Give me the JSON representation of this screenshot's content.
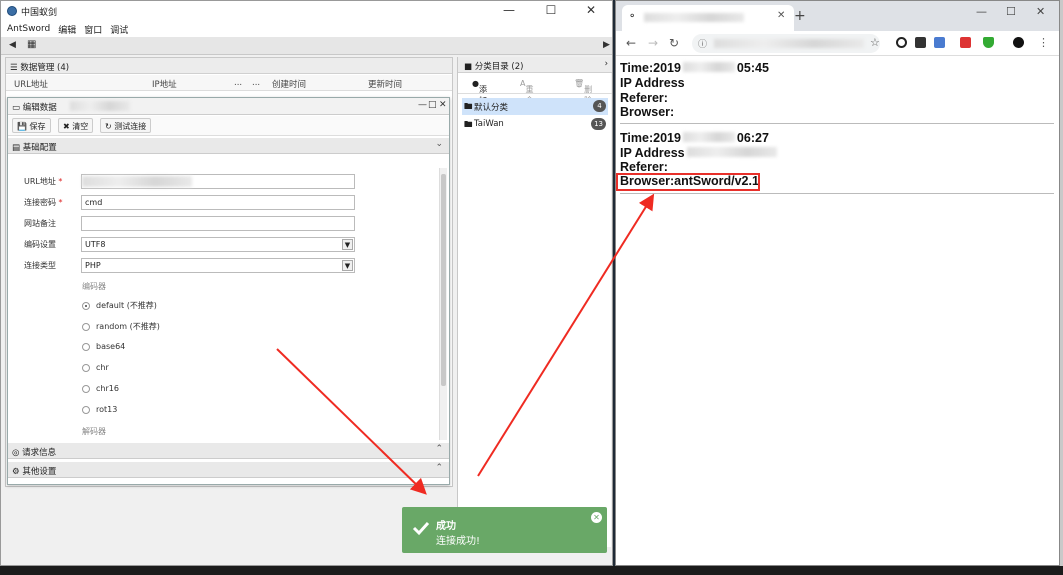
{
  "antsword": {
    "title": "中国蚁剑",
    "menu": [
      "AntSword",
      "编辑",
      "窗口",
      "调试"
    ],
    "data_panel": {
      "header": "数据管理 (4)",
      "columns": [
        "URL地址",
        "IP地址",
        "创建时间",
        "更新时间"
      ]
    },
    "edit_dialog": {
      "title": "编辑数据",
      "toolbar": {
        "save": "保存",
        "clear": "清空",
        "test": "测试连接"
      },
      "section_basic": "基础配置",
      "labels": {
        "url": "URL地址",
        "password": "连接密码",
        "note": "网站备注",
        "encoding": "编码设置",
        "type": "连接类型"
      },
      "required_mark": "*",
      "values": {
        "password": "cmd",
        "encoding": "UTF8",
        "type": "PHP"
      },
      "encoder_title": "编码器",
      "encoders": [
        "default (不推荐)",
        "random (不推荐)",
        "base64",
        "chr",
        "chr16",
        "rot13"
      ],
      "selected_encoder": 0,
      "decoder_title": "解码器",
      "section_headers": "请求信息",
      "section_other": "其他设置"
    },
    "category_panel": {
      "header": "分类目录 (2)",
      "tools": {
        "add": "添加",
        "rename": "重命名",
        "delete": "删除"
      },
      "items": [
        {
          "label": "默认分类",
          "count": "4"
        },
        {
          "label": "TaiWan",
          "count": "13"
        }
      ]
    },
    "toast": {
      "title": "成功",
      "message": "连接成功!"
    }
  },
  "browser": {
    "records": [
      {
        "time_prefix": "Time:2019",
        "time_suffix": "05:45",
        "ip": "IP Address",
        "referer": "Referer:",
        "browser": "Browser:"
      },
      {
        "time_prefix": "Time:2019",
        "time_suffix": "06:27",
        "ip": "IP Address",
        "referer": "Referer:",
        "browser": "Browser:antSword/v2.1"
      }
    ]
  },
  "colors": {
    "toast_bg": "#69a867",
    "highlight": "#e8302a",
    "selected_row": "#cfe3fa"
  }
}
